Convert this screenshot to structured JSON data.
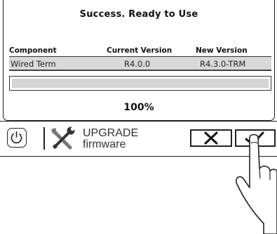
{
  "dialog": {
    "title": "Success. Ready to Use",
    "table": {
      "headers": [
        "Component",
        "Current Version",
        "New Version"
      ],
      "rows": [
        {
          "component": "Wired Term",
          "current": "R4.0.0",
          "new": "R4.3.0-TRM"
        }
      ]
    },
    "progress": {
      "value": 1.0,
      "label": "100%"
    }
  },
  "toolbar": {
    "power_icon": "power-icon",
    "tools_icon": "wrench-screwdriver-icon",
    "label_line1": "UPGRADE",
    "label_line2": "firmware",
    "cancel_icon": "close-x-icon",
    "confirm_icon": "checkmark-icon"
  }
}
